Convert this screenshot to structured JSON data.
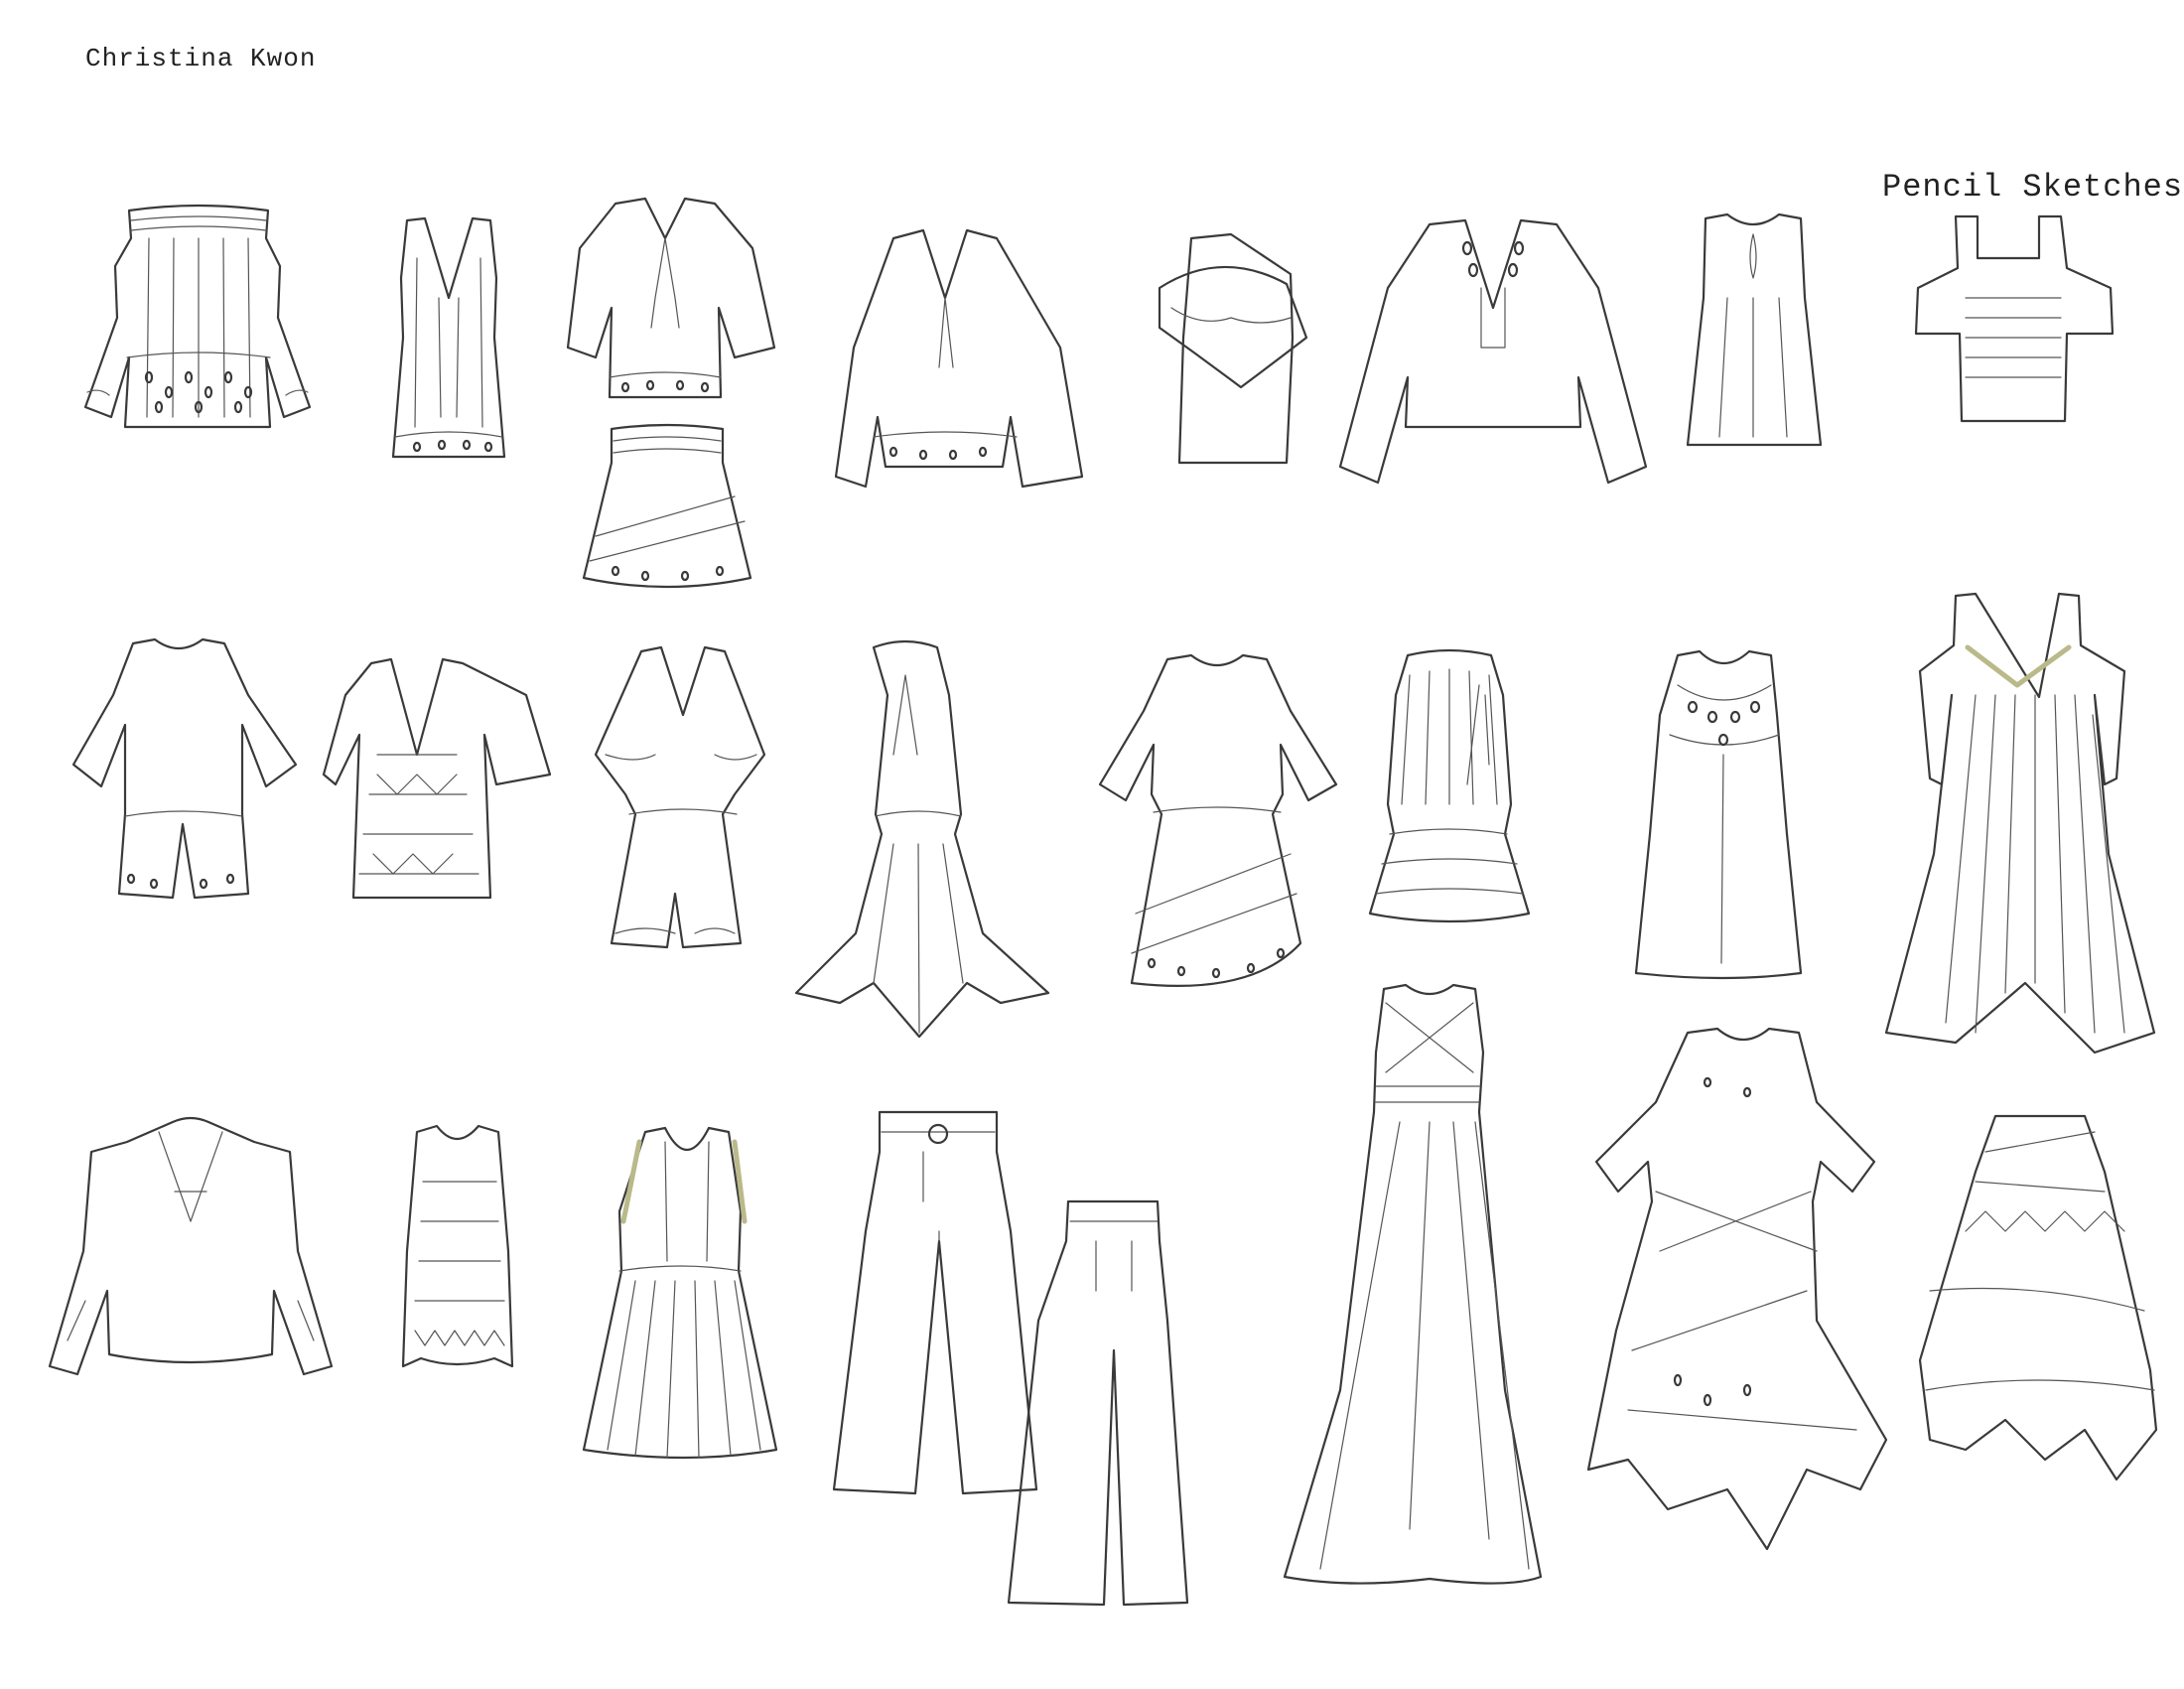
{
  "header": {
    "designer_name": "Christina Kwon",
    "section_title": "Pencil Sketches"
  },
  "colors": {
    "paper": "#ffffff",
    "ink": "#3a3a3a",
    "accent_trim": "#b9b98a"
  }
}
